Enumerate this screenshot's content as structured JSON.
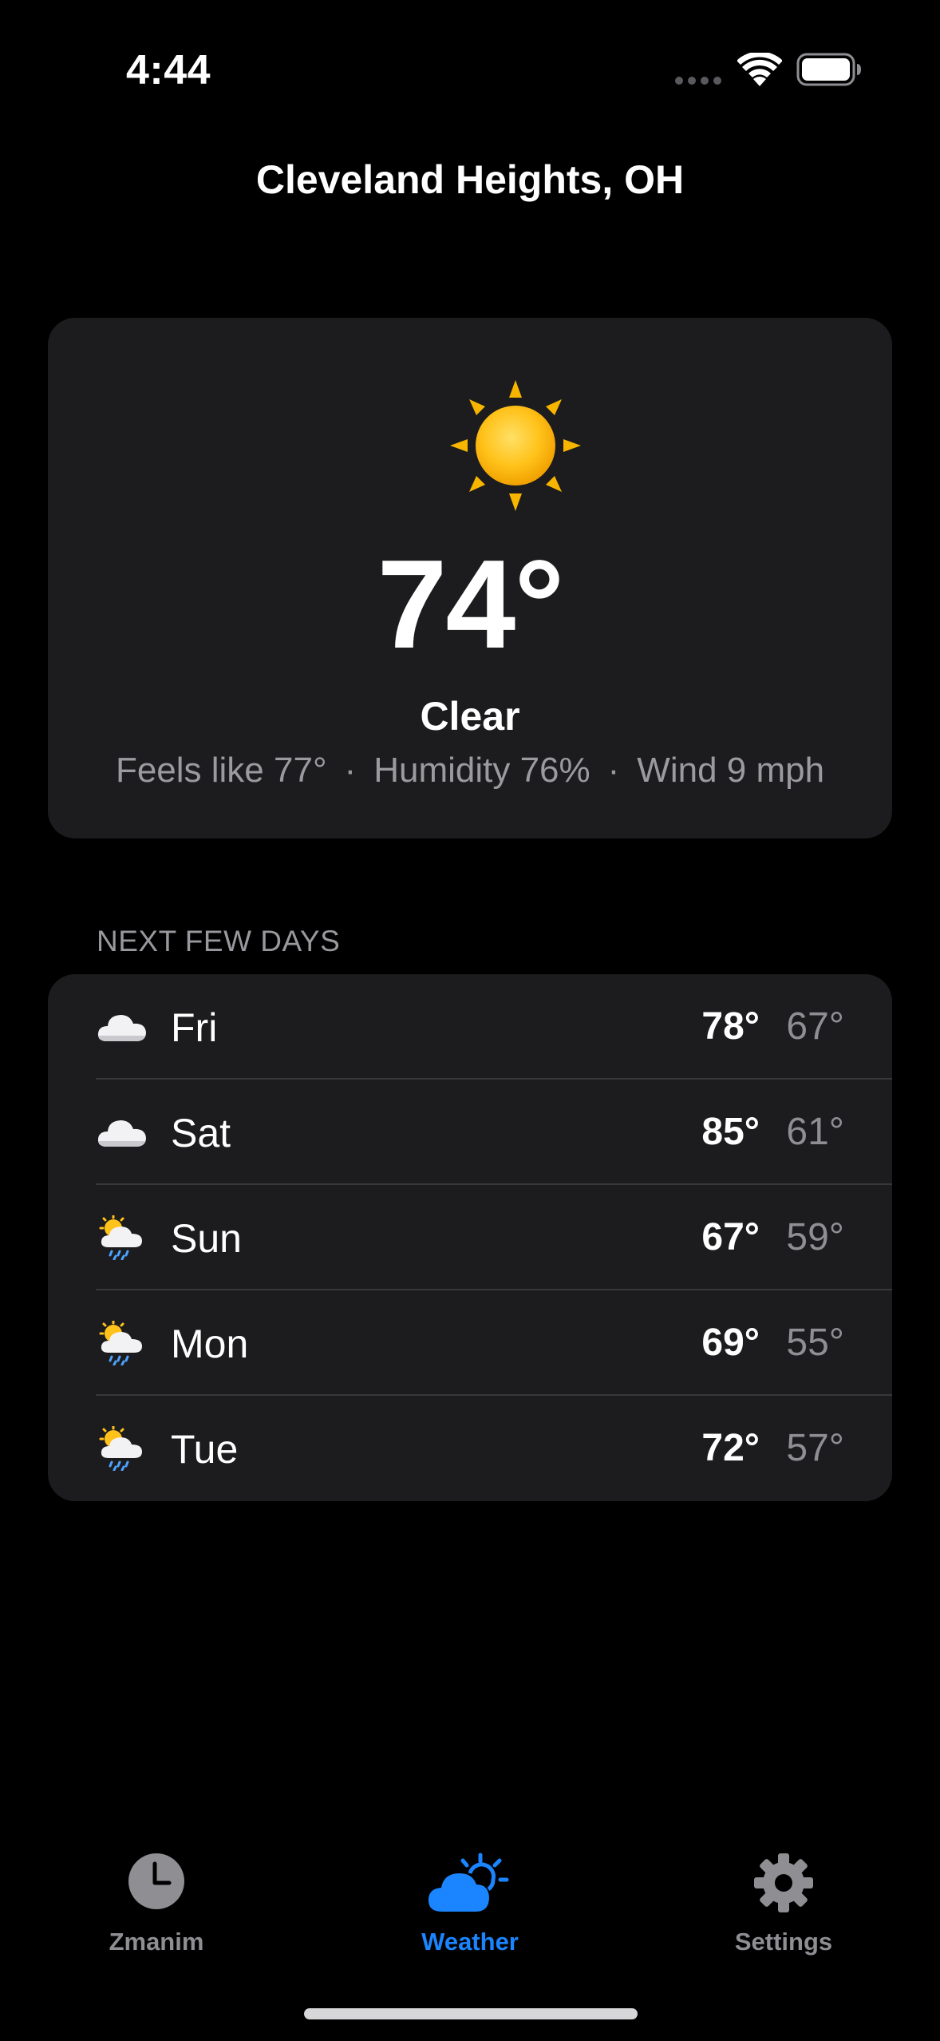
{
  "status_bar": {
    "time": "4:44"
  },
  "location": "Cleveland Heights, OH",
  "current": {
    "icon": "sun-icon",
    "temperature": "74°",
    "condition": "Clear",
    "feels_like": "Feels like 77°",
    "humidity": "Humidity 76%",
    "wind": "Wind 9 mph",
    "separator": "·"
  },
  "forecast": {
    "header": "NEXT FEW DAYS",
    "days": [
      {
        "day": "Fri",
        "icon": "cloud-icon",
        "high": "78°",
        "low": "67°"
      },
      {
        "day": "Sat",
        "icon": "cloud-icon",
        "high": "85°",
        "low": "61°"
      },
      {
        "day": "Sun",
        "icon": "sun-behind-rain-cloud-icon",
        "high": "67°",
        "low": "59°"
      },
      {
        "day": "Mon",
        "icon": "sun-behind-rain-cloud-icon",
        "high": "69°",
        "low": "55°"
      },
      {
        "day": "Tue",
        "icon": "sun-behind-rain-cloud-icon",
        "high": "72°",
        "low": "57°"
      }
    ]
  },
  "tabs": [
    {
      "label": "Zmanim",
      "icon": "clock-icon",
      "active": false
    },
    {
      "label": "Weather",
      "icon": "cloud-sun-icon",
      "active": true
    },
    {
      "label": "Settings",
      "icon": "gear-icon",
      "active": false
    }
  ],
  "colors": {
    "background": "#000000",
    "card": "#1c1c1e",
    "accent": "#1a85ff",
    "secondary_text": "#8e8e93"
  }
}
